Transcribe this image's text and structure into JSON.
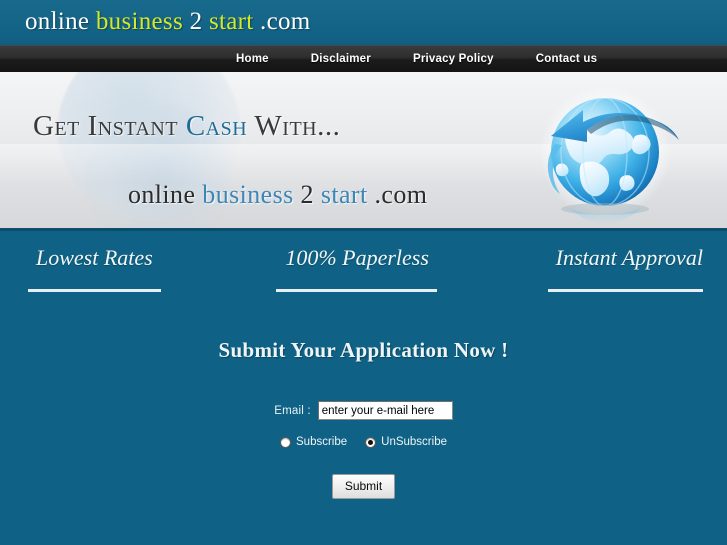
{
  "header": {
    "logo_parts": [
      {
        "text": "online",
        "color": "white"
      },
      {
        "text": "business",
        "color": "green"
      },
      {
        "text": "2",
        "color": "white"
      },
      {
        "text": "start",
        "color": "green"
      },
      {
        "text": ".com",
        "color": "white"
      }
    ],
    "logo_online": "online",
    "logo_business": "business",
    "logo_2": "2",
    "logo_start": "start",
    "logo_com": ".com",
    "bg_color": "#15678a",
    "accent_color": "#d4e82a"
  },
  "nav": {
    "bg_color": "#1b1b1b",
    "items": [
      {
        "label": "Home"
      },
      {
        "label": "Disclaimer"
      },
      {
        "label": "Privacy Policy"
      },
      {
        "label": "Contact us"
      }
    ]
  },
  "hero": {
    "line1_pre": "Get Instant ",
    "line1_accent": "Cash",
    "line1_post": " With...",
    "line2_online": "online",
    "line2_business": "business",
    "line2_2": "2",
    "line2_start": "start",
    "line2_com": ".com",
    "accent_color": "#1e6b96",
    "globe_icon": "globe-arrow-icon"
  },
  "features": [
    {
      "label": "Lowest Rates"
    },
    {
      "label": "100% Paperless"
    },
    {
      "label": "Instant Approval"
    }
  ],
  "form": {
    "title": "Submit Your Application Now !",
    "email_label": "Email :",
    "email_value": "enter your e-mail here",
    "email_placeholder": "enter your e-mail here",
    "options": [
      {
        "label": "Subscribe",
        "checked": false
      },
      {
        "label": "UnSubscribe",
        "checked": true
      }
    ],
    "subscribe_label": "Subscribe",
    "unsubscribe_label": "UnSubscribe",
    "submit_label": "Submit"
  },
  "theme": {
    "page_bg": "#0f6285",
    "hero_bg": "#e8eaec",
    "text_light": "#eef4f7"
  }
}
